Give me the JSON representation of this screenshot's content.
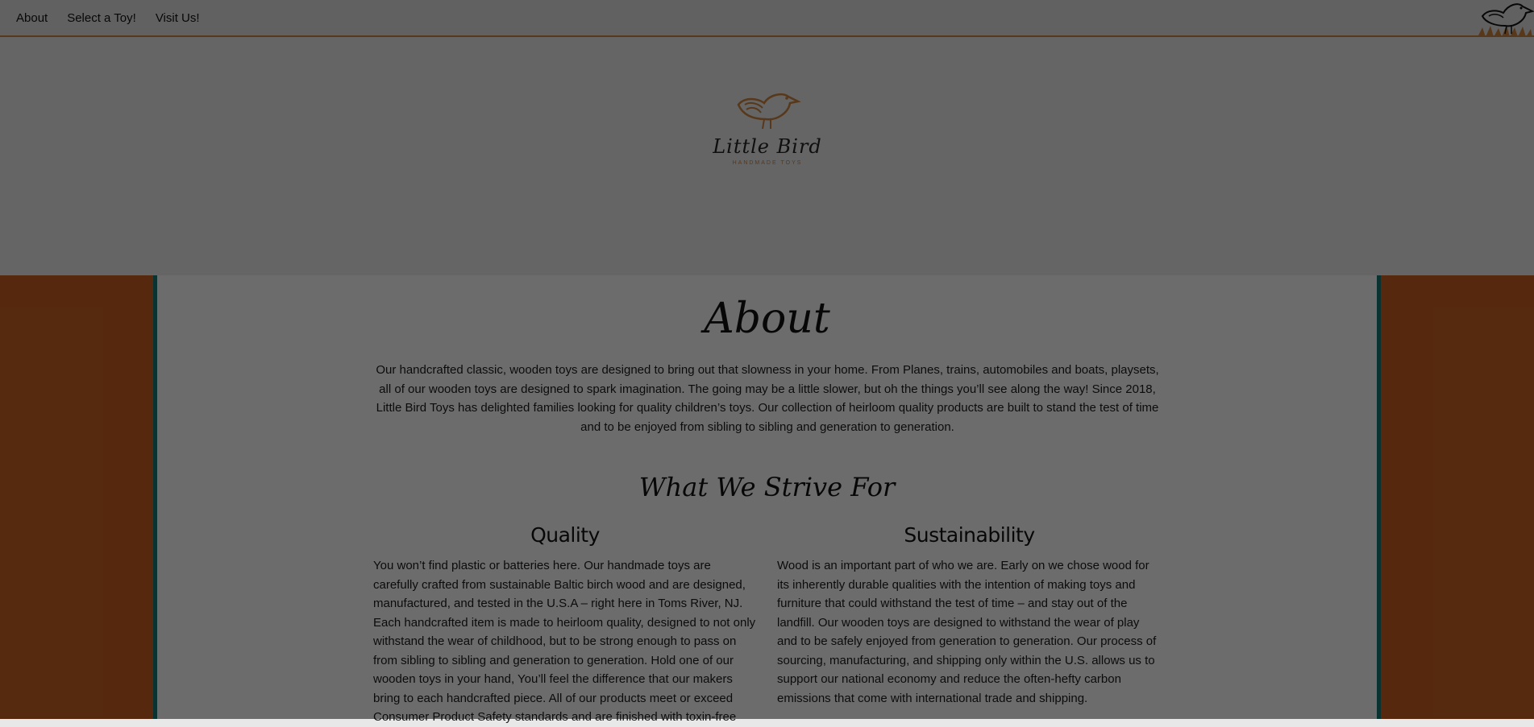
{
  "nav": {
    "links": [
      "About",
      "Select a Toy!",
      "Visit Us!"
    ]
  },
  "hero": {
    "brand_name": "Little Bird",
    "brand_sub": "HANDMADE TOYS"
  },
  "about": {
    "title": "About",
    "text": "Our handcrafted classic, wooden toys are designed to bring out that slowness in your home. From Planes, trains, automobiles and boats, playsets, all of our wooden toys are designed to spark imagination. The going may be a little slower, but oh the things you’ll see along the way! Since 2018, Little Bird Toys has delighted families looking for quality children’s toys. Our collection of heirloom quality products are built to stand the test of time and to be enjoyed from sibling to sibling and generation to generation."
  },
  "strive": {
    "title": "What We Strive For",
    "quality": {
      "title": "Quality",
      "text": "You won’t find plastic or batteries here. Our handmade toys are carefully crafted from sustainable Baltic birch wood and are designed, manufactured, and tested in the U.S.A – right here in Toms River, NJ. Each handcrafted item is made to heirloom quality, designed to not only withstand the wear of childhood, but to be strong enough to pass on from sibling to sibling and generation to generation. Hold one of our wooden toys in your hand, You’ll feel the difference that our makers bring to each handcrafted piece. All of our products meet or exceed Consumer Product Safety standards and are finished with toxin-free"
    },
    "sustainability": {
      "title": "Sustainability",
      "text": "Wood is an important part of who we are. Early on we chose wood for its inherently durable qualities with the intention of making toys and furniture that could withstand the test of time – and stay out of the landfill. Our wooden toys are designed to withstand the wear of play and to be safely enjoyed from generation to generation. Our process of sourcing, manufacturing, and shipping only within the U.S. allows us to support our national economy and reduce the often-hefty carbon emissions that come with international trade and shipping."
    }
  },
  "colors": {
    "accent_orange": "#c45f22",
    "accent_teal": "#16736e",
    "nav_border": "#c77f3f",
    "overlay": "rgba(0,0,0,0.56)"
  },
  "icons": {
    "corner_logo": "bird-nest-icon",
    "hero_logo": "bird-icon"
  }
}
